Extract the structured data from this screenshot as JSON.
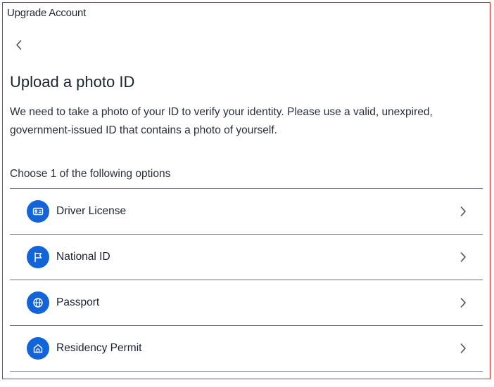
{
  "window": {
    "title": "Upgrade Account"
  },
  "page": {
    "title": "Upload a photo ID",
    "description": "We need to take a photo of your ID to verify your identity. Please use a valid, unexpired, government-issued ID that contains a photo of yourself.",
    "options_heading": "Choose 1 of the following options"
  },
  "options": [
    {
      "label": "Driver License",
      "icon": "id-card-icon"
    },
    {
      "label": "National ID",
      "icon": "flag-icon"
    },
    {
      "label": "Passport",
      "icon": "globe-icon"
    },
    {
      "label": "Residency Permit",
      "icon": "home-icon"
    }
  ],
  "colors": {
    "accent": "#1264d8",
    "border": "#d9262c",
    "divider": "#6d7280",
    "text": "#1c2230"
  }
}
